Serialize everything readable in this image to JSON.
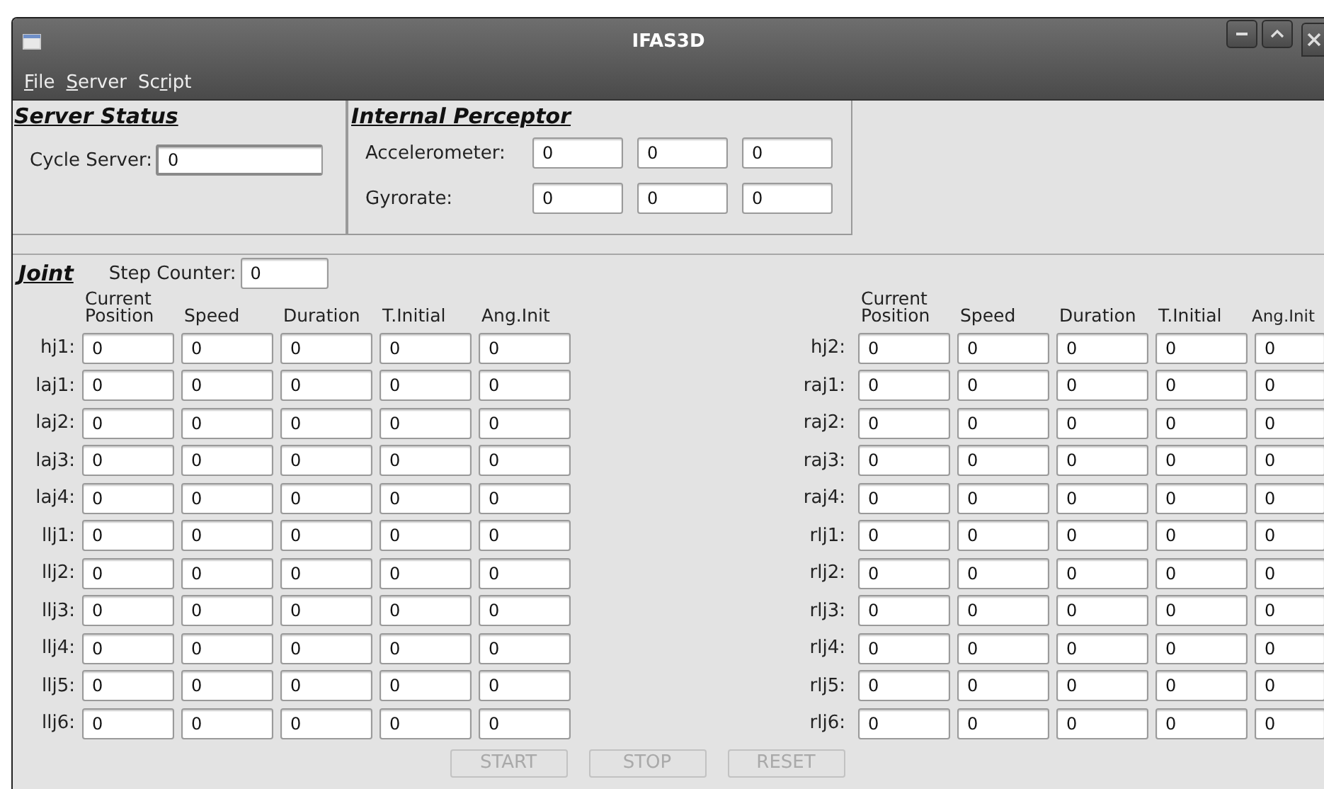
{
  "window": {
    "title": "IFAS3D"
  },
  "menu": [
    {
      "key": "F",
      "after": "ile"
    },
    {
      "key": "S",
      "after": "erver"
    },
    {
      "before": "Sc",
      "key": "r",
      "after": "ipt"
    }
  ],
  "server_status": {
    "title": "Server Status",
    "label": "Cycle Server:",
    "value": "0",
    "focused": true
  },
  "internal_perceptor": {
    "title": "Internal Perceptor",
    "rows": [
      {
        "label": "Accelerometer:",
        "values": [
          "0",
          "0",
          "0"
        ]
      },
      {
        "label": "Gyrorate:",
        "values": [
          "0",
          "0",
          "0"
        ]
      }
    ]
  },
  "joint": {
    "title": "Joint",
    "step_counter": {
      "label": "Step Counter:",
      "value": "0"
    },
    "groups": [
      {
        "columns": [
          "Current Position",
          "Speed",
          "Duration",
          "T.Initial",
          "Ang.Init"
        ],
        "rows": [
          {
            "label": "hj1:",
            "values": [
              "0",
              "0",
              "0",
              "0",
              "0"
            ]
          },
          {
            "label": "laj1:",
            "values": [
              "0",
              "0",
              "0",
              "0",
              "0"
            ]
          },
          {
            "label": "laj2:",
            "values": [
              "0",
              "0",
              "0",
              "0",
              "0"
            ]
          },
          {
            "label": "laj3:",
            "values": [
              "0",
              "0",
              "0",
              "0",
              "0"
            ]
          },
          {
            "label": "laj4:",
            "values": [
              "0",
              "0",
              "0",
              "0",
              "0"
            ]
          },
          {
            "label": "llj1:",
            "values": [
              "0",
              "0",
              "0",
              "0",
              "0"
            ]
          },
          {
            "label": "llj2:",
            "values": [
              "0",
              "0",
              "0",
              "0",
              "0"
            ]
          },
          {
            "label": "llj3:",
            "values": [
              "0",
              "0",
              "0",
              "0",
              "0"
            ]
          },
          {
            "label": "llj4:",
            "values": [
              "0",
              "0",
              "0",
              "0",
              "0"
            ]
          },
          {
            "label": "llj5:",
            "values": [
              "0",
              "0",
              "0",
              "0",
              "0"
            ]
          },
          {
            "label": "llj6:",
            "values": [
              "0",
              "0",
              "0",
              "0",
              "0"
            ]
          }
        ]
      },
      {
        "columns": [
          "Current Position",
          "Speed",
          "Duration",
          "T.Initial",
          "Ang.Init"
        ],
        "rows": [
          {
            "label": "hj2:",
            "values": [
              "0",
              "0",
              "0",
              "0",
              "0"
            ]
          },
          {
            "label": "raj1:",
            "values": [
              "0",
              "0",
              "0",
              "0",
              "0"
            ]
          },
          {
            "label": "raj2:",
            "values": [
              "0",
              "0",
              "0",
              "0",
              "0"
            ]
          },
          {
            "label": "raj3:",
            "values": [
              "0",
              "0",
              "0",
              "0",
              "0"
            ]
          },
          {
            "label": "raj4:",
            "values": [
              "0",
              "0",
              "0",
              "0",
              "0"
            ]
          },
          {
            "label": "rlj1:",
            "values": [
              "0",
              "0",
              "0",
              "0",
              "0"
            ]
          },
          {
            "label": "rlj2:",
            "values": [
              "0",
              "0",
              "0",
              "0",
              "0"
            ]
          },
          {
            "label": "rlj3:",
            "values": [
              "0",
              "0",
              "0",
              "0",
              "0"
            ]
          },
          {
            "label": "rlj4:",
            "values": [
              "0",
              "0",
              "0",
              "0",
              "0"
            ]
          },
          {
            "label": "rlj5:",
            "values": [
              "0",
              "0",
              "0",
              "0",
              "0"
            ]
          },
          {
            "label": "rlj6:",
            "values": [
              "0",
              "0",
              "0",
              "0",
              "0"
            ]
          }
        ]
      }
    ]
  },
  "buttons": [
    {
      "label": "START",
      "disabled": true
    },
    {
      "label": "STOP",
      "disabled": true
    },
    {
      "label": "RESET",
      "disabled": true
    }
  ]
}
